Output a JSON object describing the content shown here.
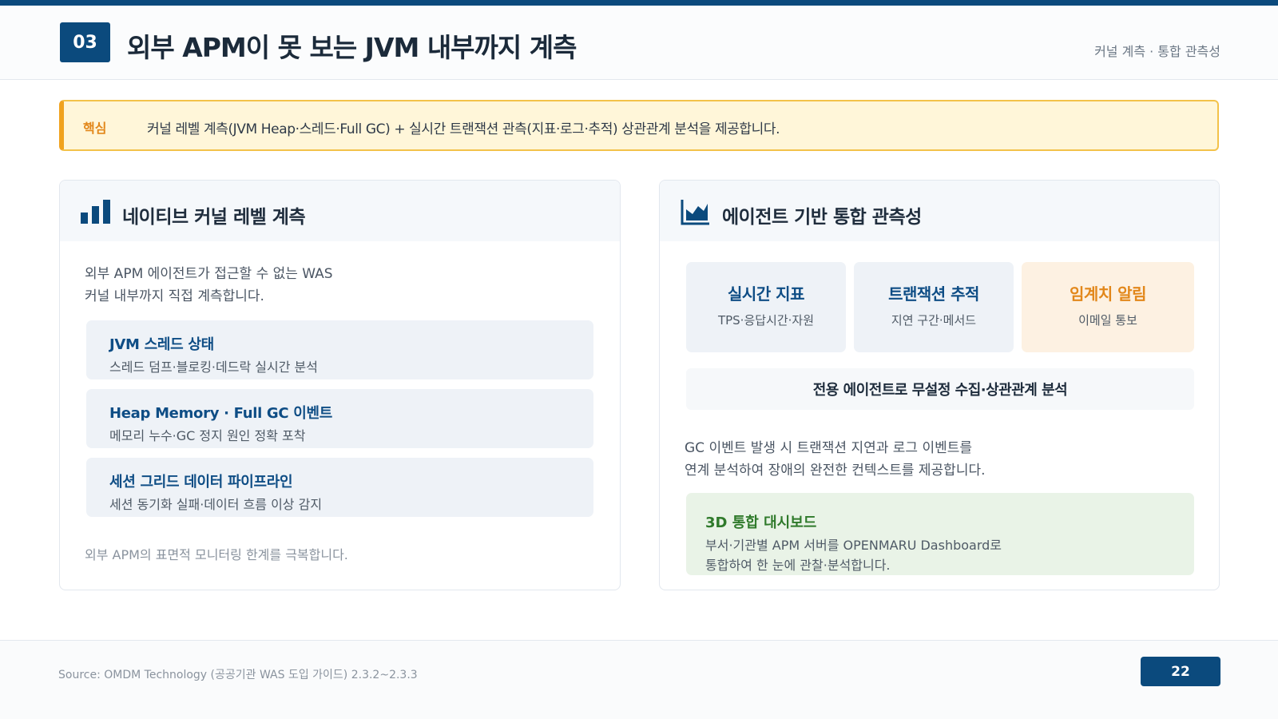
{
  "header": {
    "section_number": "03",
    "title": "외부 APM이 못 보는 JVM 내부까지 계측",
    "subtitle": "커널 계측 · 통합 관측성"
  },
  "key_point": {
    "label": "핵심",
    "text": "커널 레벨 계측(JVM Heap·스레드·Full GC) + 실시간 트랜잭션 관측(지표·로그·추적) 상관관계 분석을 제공합니다."
  },
  "left_card": {
    "icon": "bar-chart-icon",
    "title": "네이티브 커널 레벨 계측",
    "intro_line1": "외부 APM 에이전트가 접근할 수 없는 WAS",
    "intro_line2": "커널 내부까지 직접 계측합니다.",
    "features": [
      {
        "title": "JVM 스레드 상태",
        "desc": "스레드 덤프·블로킹·데드락 실시간 분석"
      },
      {
        "title": "Heap Memory · Full GC 이벤트",
        "desc": "메모리 누수·GC 정지 원인 정확 포착"
      },
      {
        "title": "세션 그리드 데이터 파이프라인",
        "desc": "세션 동기화 실패·데이터 흐름 이상 감지"
      }
    ],
    "footer_note": "외부 APM의 표면적 모니터링 한계를 극복합니다."
  },
  "right_card": {
    "icon": "area-chart-icon",
    "title": "에이전트 기반 통합 관측성",
    "tiles": [
      {
        "title": "실시간 지표",
        "desc": "TPS·응답시간·자원"
      },
      {
        "title": "트랜잭션 추적",
        "desc": "지연 구간·메서드"
      },
      {
        "title": "임계치 알림",
        "desc": "이메일 통보"
      }
    ],
    "agent_bar": "전용 에이전트로 무설정 수집·상관관계 분석",
    "para_line1": "GC 이벤트 발생 시 트랜잭션 지연과 로그 이벤트를",
    "para_line2": "연계 분석하여 장애의 완전한 컨텍스트를 제공합니다.",
    "dashboard": {
      "title": "3D 통합 대시보드",
      "desc_line1": "부서·기관별 APM 서버를 OPENMARU Dashboard로",
      "desc_line2": "통합하여 한 눈에 관찰·분석합니다."
    }
  },
  "footer": {
    "source": "Source: OMDM Technology (공공기관 WAS 도입 가이드) 2.3.2~2.3.3",
    "page_number": "22"
  },
  "colors": {
    "primary": "#0b4a7d",
    "accent_orange": "#f0a21e",
    "dashboard_green": "#2f7a2b"
  }
}
